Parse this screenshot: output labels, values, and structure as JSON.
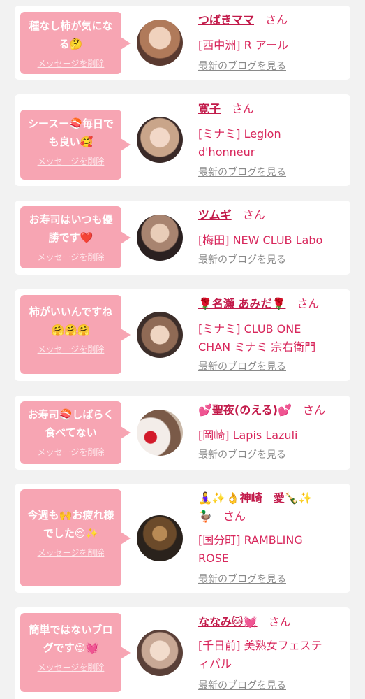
{
  "ui": {
    "delete_label": "メッセージを削除",
    "blog_label": "最新のブログを見る",
    "honorific": "さん"
  },
  "colors": {
    "bubble": "#f7a5b3",
    "name": "#c21a4a",
    "shop": "#d8275c",
    "link_gray": "#8a8a8a"
  },
  "entries": [
    {
      "message": "種なし柿が気になる🤔",
      "name": "つばきママ",
      "shop": "[西中洲] R アール"
    },
    {
      "message": "シースー🍣毎日でも良い🥰",
      "name": "寛子",
      "shop": "[ミナミ] Legion\nd'honneur"
    },
    {
      "message": "お寿司はいつも優勝です❤️",
      "name": "ツムギ",
      "shop": "[梅田] NEW CLUB Labo"
    },
    {
      "message": "柿がいいんですね🤗🤗🤗",
      "name": "🌹名瀬 あみだ🌹",
      "shop": "[ミナミ] CLUB ONE\nCHAN ミナミ 宗右衛門"
    },
    {
      "message": "お寿司🍣しばらく食べてない",
      "name": "💕聖夜(のえる)💕",
      "shop": "[岡崎] Lapis Lazuli"
    },
    {
      "message": "今週も🙌お疲れ様でした😌✨",
      "name": "🧘‍♀️✨👌神崎　愛🍾✨\n🦆",
      "shop": "[国分町] RAMBLING\nROSE"
    },
    {
      "message": "簡単ではないブログです😌💓",
      "name": "ななみ🐱💓",
      "shop": "[千日前] 美熟女フェステ\nィバル"
    }
  ]
}
